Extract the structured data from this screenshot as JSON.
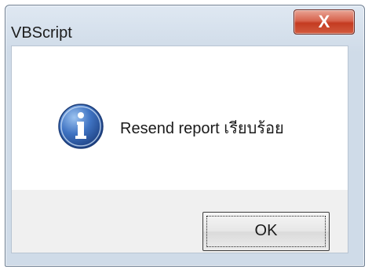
{
  "window": {
    "title": "VBScript",
    "close_glyph": "X"
  },
  "dialog": {
    "icon": "info-icon",
    "message": "Resend report เรียบร้อย",
    "ok_label": "OK"
  },
  "colors": {
    "close_button": "#c43b21",
    "icon_blue": "#2d5ea9",
    "title_bar": "#dfe8f2"
  }
}
